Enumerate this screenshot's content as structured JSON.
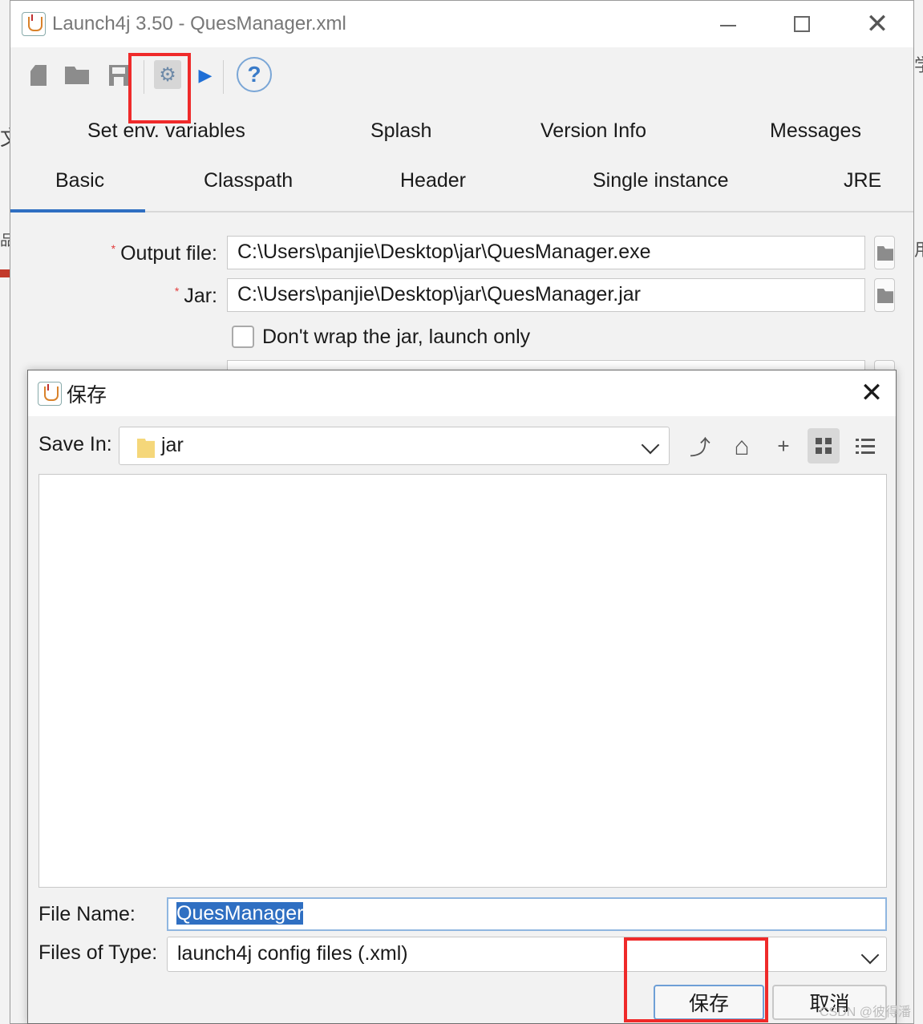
{
  "window": {
    "title": "Launch4j 3.50 - QuesManager.xml",
    "close_glyph": "✕"
  },
  "toolbar": {
    "buttons": [
      {
        "icon": "new-file-icon"
      },
      {
        "icon": "open-folder-icon"
      },
      {
        "icon": "save-disk-icon"
      },
      {
        "icon": "gear-icon",
        "glyph": "⚙"
      },
      {
        "icon": "run-icon",
        "glyph": "▶"
      },
      {
        "icon": "help-icon",
        "glyph": "?"
      }
    ]
  },
  "tabs": {
    "row1": [
      "Set env. variables",
      "Splash",
      "Version Info",
      "Messages"
    ],
    "row2": [
      "Basic",
      "Classpath",
      "Header",
      "Single instance",
      "JRE"
    ],
    "active": "Basic"
  },
  "basic": {
    "output_label": "Output file:",
    "output_value": "C:\\Users\\panjie\\Desktop\\jar\\QuesManager.exe",
    "jar_label": "Jar:",
    "jar_value": "C:\\Users\\panjie\\Desktop\\jar\\QuesManager.jar",
    "required_mark": "*",
    "dont_wrap_label": "Don't wrap the jar, launch only"
  },
  "dialog": {
    "title": "保存",
    "close_glyph": "✕",
    "save_in_label": "Save In:",
    "save_in_value": "jar",
    "file_name_label": "File Name:",
    "file_name_value": "QuesManager",
    "files_of_type_label": "Files of Type:",
    "files_of_type_value": "launch4j config files (.xml)",
    "save_button": "保存",
    "cancel_button": "取消",
    "tools": [
      {
        "icon": "up-folder-icon",
        "glyph": "⤴"
      },
      {
        "icon": "home-icon",
        "glyph": "⌂"
      },
      {
        "icon": "new-folder-icon",
        "glyph": "+"
      },
      {
        "icon": "grid-view-icon"
      },
      {
        "icon": "list-view-icon"
      }
    ]
  },
  "background_fragments": {
    "left": [
      "文",
      "品"
    ],
    "right": [
      "学",
      "用"
    ]
  },
  "watermark": "CSDN @彼得潘",
  "colors": {
    "highlight": "#ef2a2a",
    "tab_underline": "#2f6fc2",
    "selection": "#2f6fc2"
  }
}
